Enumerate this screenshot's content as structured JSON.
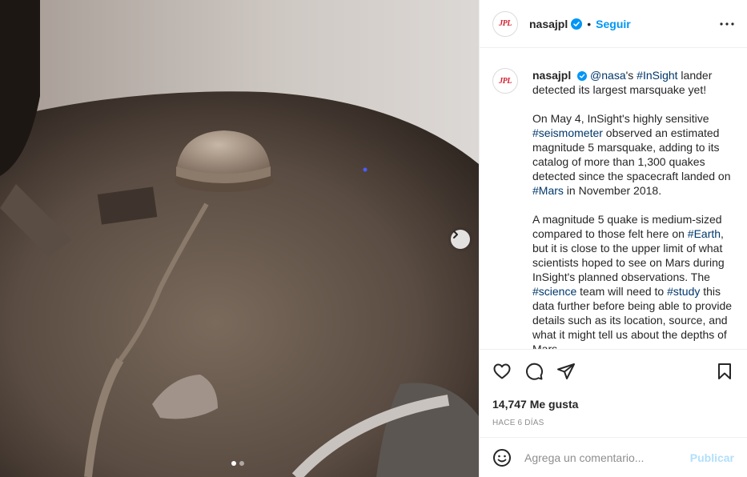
{
  "post": {
    "username": "nasajpl",
    "follow_label": "Seguir",
    "separator": "•",
    "avatar_text": "JPL",
    "caption": {
      "line1_mention": "@nasa",
      "line1_text_a": "'s ",
      "line1_hashtag": "#InSight",
      "line1_text_b": " lander detected its largest marsquake yet!",
      "p2_a": "On May 4, InSight's highly sensitive ",
      "p2_tag1": "#seismometer",
      "p2_b": " observed an estimated magnitude 5 marsquake, adding to its catalog of more than 1,300 quakes detected since the spacecraft landed on ",
      "p2_tag2": "#Mars",
      "p2_c": " in November 2018.",
      "p3_a": "A magnitude 5 quake is medium-sized compared to those felt here on ",
      "p3_tag1": "#Earth",
      "p3_b": ", but it is close to the upper limit of what scientists hoped to see on Mars during InSight's planned observations. The ",
      "p3_tag2": "#science",
      "p3_c": " team will need to ",
      "p3_tag3": "#study",
      "p3_d": " this data further before being able to provide details such as its location, source, and what it might tell us about the depths of Mars."
    },
    "likes": "14,747 Me gusta",
    "timestamp": "Hace 6 días",
    "comment_placeholder": "Agrega un comentario...",
    "publish_label": "Publicar",
    "carousel": {
      "count": 2,
      "active": 1
    }
  },
  "icons": {
    "verified": "verified-badge-icon",
    "more": "more-options-icon",
    "like": "heart-icon",
    "comment": "comment-bubble-icon",
    "share": "paper-plane-icon",
    "save": "bookmark-icon",
    "emoji": "smiley-icon",
    "next": "chevron-right-icon"
  },
  "colors": {
    "accent": "#0095f6",
    "verified": "#0095f6",
    "hashtag": "#00376b",
    "jpl_red": "#d1202f",
    "publish_disabled": "#b2dffc"
  }
}
